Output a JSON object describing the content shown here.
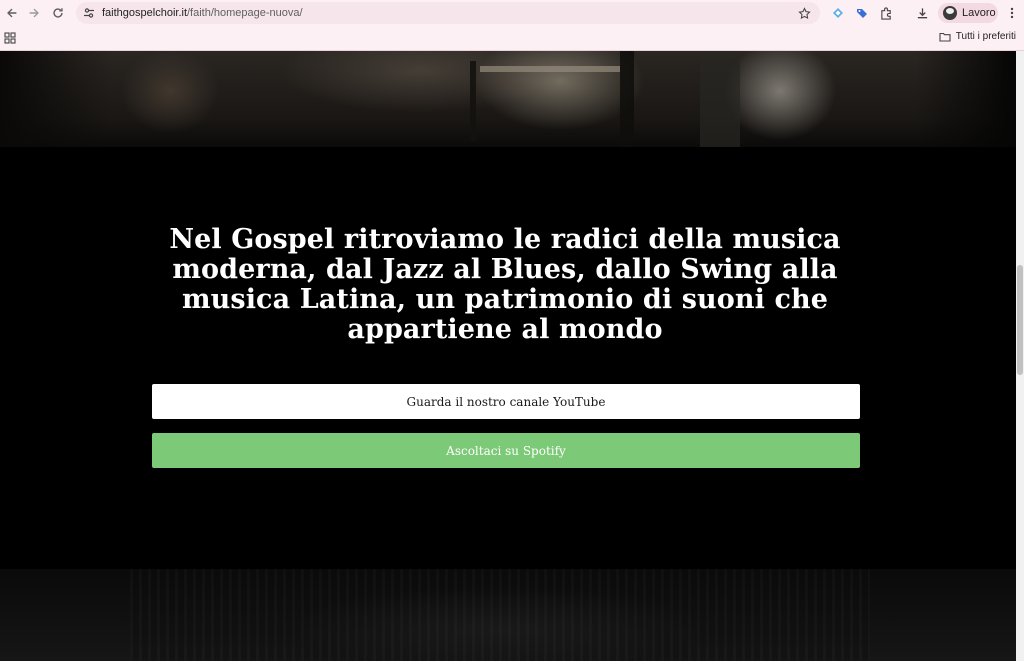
{
  "browser": {
    "url_domain": "faithgospelchoir.it",
    "url_path": "/faith/homepage-nuova/",
    "profile_name": "Lavoro",
    "bookmarks_all_label": "Tutti i preferiti",
    "icons": {
      "back": "arrow-left-icon",
      "forward": "arrow-right-icon",
      "reload": "reload-icon",
      "site_info": "tune-icon",
      "bookmark_star": "star-icon",
      "extensions": [
        "extension-diamond-icon",
        "extension-tag-icon",
        "puzzle-icon"
      ],
      "download": "download-icon",
      "menu": "kebab-menu-icon",
      "apps": "grid-icon",
      "folder": "folder-icon"
    }
  },
  "page": {
    "headline": "Nel Gospel ritroviamo le radici della musica moderna, dal Jazz al Blues, dallo Swing alla musica Latina, un patrimonio di suoni che appartiene al mondo",
    "youtube_button": "Guarda il nostro canale YouTube",
    "spotify_button": "Ascoltaci su Spotify"
  },
  "colors": {
    "background": "#000000",
    "headline": "#ffffff",
    "youtube_button_bg": "#ffffff",
    "spotify_button_bg": "#7cc977",
    "chrome_bg": "#fdf0f4"
  }
}
